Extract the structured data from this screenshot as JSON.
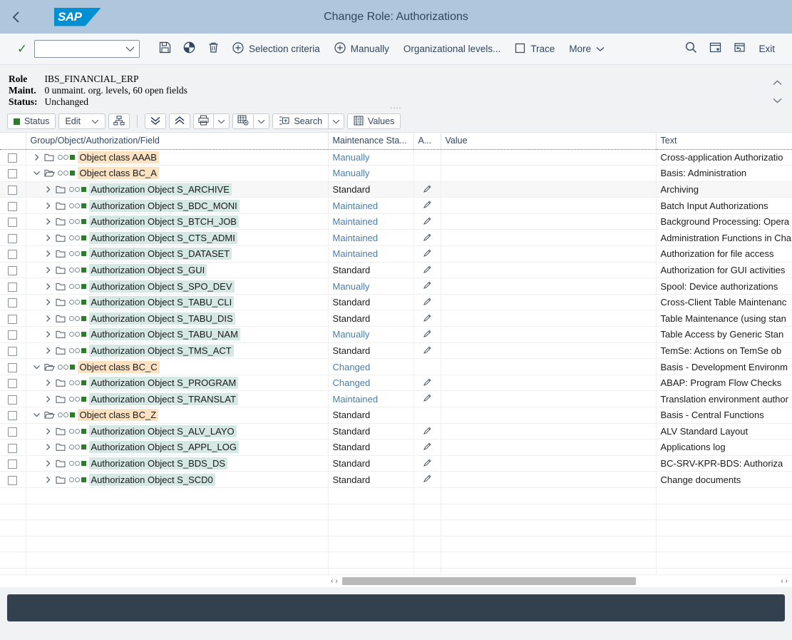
{
  "shell": {
    "title": "Change Role: Authorizations",
    "logo_text": "SAP",
    "back_icon": "back-chevron-icon"
  },
  "toolbar": {
    "confirm_icon": "checkmark-icon",
    "role_select_value": "",
    "role_select_placeholder": "",
    "save_icon": "save-icon",
    "generate_icon": "pie-chart-icon",
    "delete_icon": "trash-icon",
    "selection_criteria_label": "Selection criteria",
    "manually_label": "Manually",
    "organizational_levels_label": "Organizational levels...",
    "trace_label": "Trace",
    "more_label": "More",
    "search_icon": "search-icon",
    "personalize_icon": "window-favorite-icon",
    "window_icon": "window-restore-icon",
    "exit_label": "Exit"
  },
  "info": {
    "role_label": "Role",
    "role_value": "IBS_FINANCIAL_ERP",
    "maint_label": "Maint.",
    "maint_value": "0 unmaint. org. levels, 60 open fields",
    "status_label": "Status:",
    "status_value": "Unchanged",
    "collapse_up_icon": "chevron-up-icon",
    "collapse_down_icon": "chevron-down-icon",
    "drag_handle": "...."
  },
  "subtoolbar": {
    "status_label": "Status",
    "edit_label": "Edit",
    "hierarchy_icon": "hierarchy-icon",
    "expand_all_icon": "expand-all-icon",
    "collapse_all_icon": "collapse-all-icon",
    "print_icon": "print-icon",
    "layout_icon": "table-settings-icon",
    "search_label": "Search",
    "values_label": "Values"
  },
  "table": {
    "columns": [
      {
        "key": "chk",
        "label": ""
      },
      {
        "key": "name",
        "label": "Group/Object/Authorization/Field"
      },
      {
        "key": "mnt",
        "label": "Maintenance Sta..."
      },
      {
        "key": "a",
        "label": "A..."
      },
      {
        "key": "val",
        "label": "Value"
      },
      {
        "key": "txt",
        "label": "Text"
      }
    ],
    "rows": [
      {
        "level": 0,
        "expanded": false,
        "name": "Object class AAAB",
        "kind": "class",
        "mnt": "Manually",
        "mnt_link": true,
        "pencil": false,
        "value": "",
        "text": "Cross-application Authorizatio",
        "focus": true,
        "alt": false
      },
      {
        "level": 0,
        "expanded": true,
        "name": "Object class BC_A",
        "kind": "class",
        "mnt": "Manually",
        "mnt_link": true,
        "pencil": false,
        "value": "",
        "text": "Basis: Administration",
        "focus": false,
        "alt": false
      },
      {
        "level": 1,
        "expanded": false,
        "name": "Authorization Object S_ARCHIVE",
        "kind": "object",
        "mnt": "Standard",
        "mnt_link": false,
        "pencil": true,
        "value": "",
        "text": "Archiving",
        "focus": false,
        "alt": true
      },
      {
        "level": 1,
        "expanded": false,
        "name": "Authorization Object S_BDC_MONI",
        "kind": "object",
        "mnt": "Maintained",
        "mnt_link": true,
        "pencil": true,
        "value": "",
        "text": "Batch Input Authorizations",
        "focus": false,
        "alt": false
      },
      {
        "level": 1,
        "expanded": false,
        "name": "Authorization Object S_BTCH_JOB",
        "kind": "object",
        "mnt": "Maintained",
        "mnt_link": true,
        "pencil": true,
        "value": "",
        "text": "Background Processing: Opera",
        "focus": false,
        "alt": false
      },
      {
        "level": 1,
        "expanded": false,
        "name": "Authorization Object S_CTS_ADMI",
        "kind": "object",
        "mnt": "Maintained",
        "mnt_link": true,
        "pencil": true,
        "value": "",
        "text": "Administration Functions in Cha",
        "focus": false,
        "alt": false
      },
      {
        "level": 1,
        "expanded": false,
        "name": "Authorization Object S_DATASET",
        "kind": "object",
        "mnt": "Maintained",
        "mnt_link": true,
        "pencil": true,
        "value": "",
        "text": "Authorization for file access",
        "focus": false,
        "alt": false
      },
      {
        "level": 1,
        "expanded": false,
        "name": "Authorization Object S_GUI",
        "kind": "object",
        "mnt": "Standard",
        "mnt_link": false,
        "pencil": true,
        "value": "",
        "text": "Authorization for GUI activities",
        "focus": false,
        "alt": false
      },
      {
        "level": 1,
        "expanded": false,
        "name": "Authorization Object S_SPO_DEV",
        "kind": "object",
        "mnt": "Manually",
        "mnt_link": true,
        "pencil": true,
        "value": "",
        "text": "Spool: Device authorizations",
        "focus": false,
        "alt": false
      },
      {
        "level": 1,
        "expanded": false,
        "name": "Authorization Object S_TABU_CLI",
        "kind": "object",
        "mnt": "Standard",
        "mnt_link": false,
        "pencil": true,
        "value": "",
        "text": "Cross-Client Table Maintenanc",
        "focus": false,
        "alt": false
      },
      {
        "level": 1,
        "expanded": false,
        "name": "Authorization Object S_TABU_DIS",
        "kind": "object",
        "mnt": "Standard",
        "mnt_link": false,
        "pencil": true,
        "value": "",
        "text": "Table Maintenance (using stan",
        "focus": false,
        "alt": false
      },
      {
        "level": 1,
        "expanded": false,
        "name": "Authorization Object S_TABU_NAM",
        "kind": "object",
        "mnt": "Manually",
        "mnt_link": true,
        "pencil": true,
        "value": "",
        "text": "Table Access by Generic Stan",
        "focus": false,
        "alt": false
      },
      {
        "level": 1,
        "expanded": false,
        "name": "Authorization Object S_TMS_ACT",
        "kind": "object",
        "mnt": "Standard",
        "mnt_link": false,
        "pencil": true,
        "value": "",
        "text": "TemSe: Actions on TemSe ob",
        "focus": false,
        "alt": false
      },
      {
        "level": 0,
        "expanded": true,
        "name": "Object class BC_C",
        "kind": "class",
        "mnt": "Changed",
        "mnt_link": true,
        "pencil": false,
        "value": "",
        "text": "Basis - Development Environm",
        "focus": false,
        "alt": false
      },
      {
        "level": 1,
        "expanded": false,
        "name": "Authorization Object S_PROGRAM",
        "kind": "object",
        "mnt": "Changed",
        "mnt_link": true,
        "pencil": true,
        "value": "",
        "text": "ABAP: Program Flow Checks",
        "focus": false,
        "alt": false
      },
      {
        "level": 1,
        "expanded": false,
        "name": "Authorization Object S_TRANSLAT",
        "kind": "object",
        "mnt": "Maintained",
        "mnt_link": true,
        "pencil": true,
        "value": "",
        "text": "Translation environment author",
        "focus": false,
        "alt": false
      },
      {
        "level": 0,
        "expanded": true,
        "name": "Object class BC_Z",
        "kind": "class",
        "mnt": "Standard",
        "mnt_link": false,
        "pencil": false,
        "value": "",
        "text": "Basis - Central Functions",
        "focus": false,
        "alt": false
      },
      {
        "level": 1,
        "expanded": false,
        "name": "Authorization Object S_ALV_LAYO",
        "kind": "object",
        "mnt": "Standard",
        "mnt_link": false,
        "pencil": true,
        "value": "",
        "text": "ALV Standard Layout",
        "focus": false,
        "alt": false
      },
      {
        "level": 1,
        "expanded": false,
        "name": "Authorization Object S_APPL_LOG",
        "kind": "object",
        "mnt": "Standard",
        "mnt_link": false,
        "pencil": true,
        "value": "",
        "text": "Applications log",
        "focus": false,
        "alt": false
      },
      {
        "level": 1,
        "expanded": false,
        "name": "Authorization Object S_BDS_DS",
        "kind": "object",
        "mnt": "Standard",
        "mnt_link": false,
        "pencil": true,
        "value": "",
        "text": "BC-SRV-KPR-BDS: Authoriza",
        "focus": false,
        "alt": false
      },
      {
        "level": 1,
        "expanded": false,
        "name": "Authorization Object S_SCD0",
        "kind": "object",
        "mnt": "Standard",
        "mnt_link": false,
        "pencil": true,
        "value": "",
        "text": "Change documents",
        "focus": false,
        "alt": false
      }
    ],
    "empty_row_count": 6
  },
  "scrollbar": {
    "left_arrow": "‹",
    "right_arrow": "›"
  },
  "colors": {
    "shell_header": "#afc6dd",
    "sap_blue": "#008fd3",
    "link": "#4a7daa",
    "green": "#2b7d2b",
    "class_highlight": "#fbe2c2",
    "object_highlight": "#d5e8e3",
    "footer": "#33414f"
  }
}
